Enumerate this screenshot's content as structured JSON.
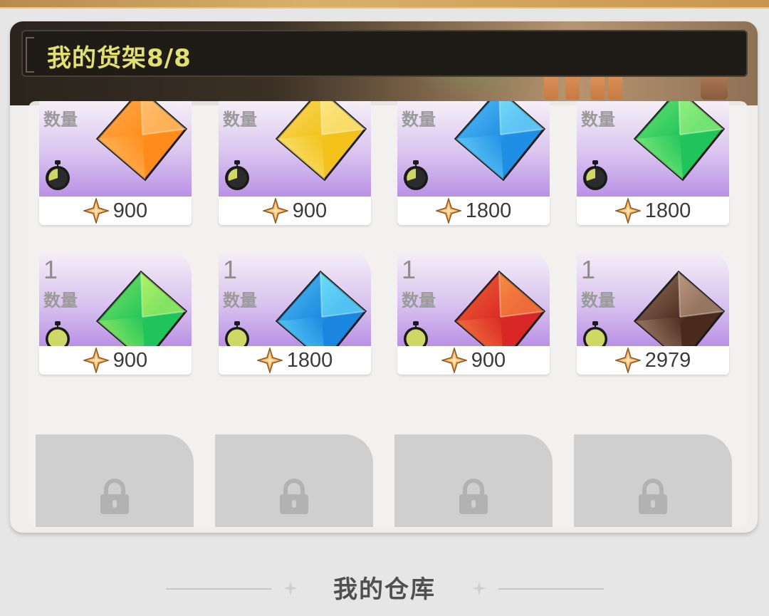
{
  "shelf": {
    "title": "我的货架8/8"
  },
  "qty_label": "数量",
  "items": [
    {
      "qty": "",
      "price": "900",
      "gem": "orange",
      "gem_color": "#ff8c1a",
      "gem_light": "#ffd08a",
      "timer_fill": "#2b2b2b"
    },
    {
      "qty": "",
      "price": "900",
      "gem": "yellow",
      "gem_color": "#f2c21a",
      "gem_light": "#fff3a8",
      "timer_fill": "#2b2b2b"
    },
    {
      "qty": "",
      "price": "1800",
      "gem": "blue",
      "gem_color": "#1f8fe6",
      "gem_light": "#8ff0ff",
      "timer_fill": "#2b2b2b"
    },
    {
      "qty": "",
      "price": "1800",
      "gem": "green",
      "gem_color": "#1fc45a",
      "gem_light": "#b8ff8a",
      "timer_fill": "#2b2b2b"
    },
    {
      "qty": "1",
      "price": "900",
      "gem": "green",
      "gem_color": "#1fc45a",
      "gem_light": "#d6ff6a",
      "timer_fill": "#cfd765"
    },
    {
      "qty": "1",
      "price": "1800",
      "gem": "blue",
      "gem_color": "#1a86e0",
      "gem_light": "#7ff4ff",
      "timer_fill": "#cfd765"
    },
    {
      "qty": "1",
      "price": "900",
      "gem": "red",
      "gem_color": "#d92626",
      "gem_light": "#ffa64a",
      "timer_fill": "#cfd765"
    },
    {
      "qty": "1",
      "price": "2979",
      "gem": "brown",
      "gem_color": "#4a2a1c",
      "gem_light": "#d7b49a",
      "timer_fill": "#cfd765"
    }
  ],
  "locked_slots": 4,
  "footer": {
    "title": "我的仓库"
  },
  "colors": {
    "title_text": "#e3e072",
    "card_purple": "#b98fe5",
    "locked_slot": "#d0cfd0"
  }
}
